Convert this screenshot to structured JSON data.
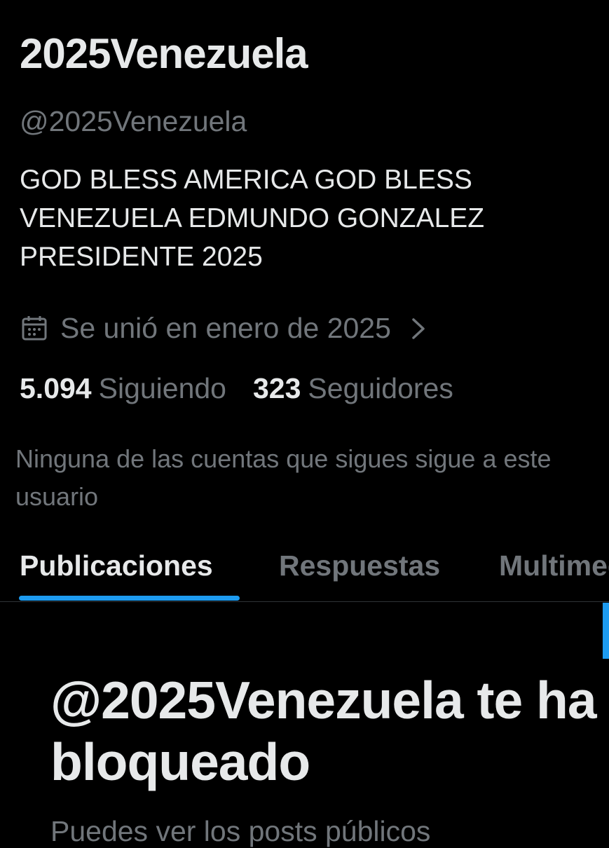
{
  "profile": {
    "display_name": "2025Venezuela",
    "handle": "@2025Venezuela",
    "bio": "GOD BLESS AMERICA GOD BLESS VENEZUELA EDMUNDO GONZALEZ PRESIDENTE 2025",
    "joined": "Se unió en enero de 2025",
    "joined_icon": "calendar-icon",
    "joined_chevron_icon": "chevron-right-icon"
  },
  "stats": {
    "following_count": "5.094",
    "following_label": "Siguiendo",
    "followers_count": "323",
    "followers_label": "Seguidores"
  },
  "mutual_text": "Ninguna de las cuentas que sigues sigue a este usuario",
  "tabs": [
    {
      "label": "Publicaciones",
      "active": true
    },
    {
      "label": "Respuestas",
      "active": false
    },
    {
      "label": "Multimedia",
      "active": false
    }
  ],
  "blocked": {
    "title": "@2025Venezuela te ha bloqueado",
    "subtitle": "Puedes ver los posts públicos"
  },
  "colors": {
    "background": "#000000",
    "primary_text": "#e7e9ea",
    "secondary_text": "#71767b",
    "accent": "#1d9bf0",
    "divider": "#2f3336"
  }
}
